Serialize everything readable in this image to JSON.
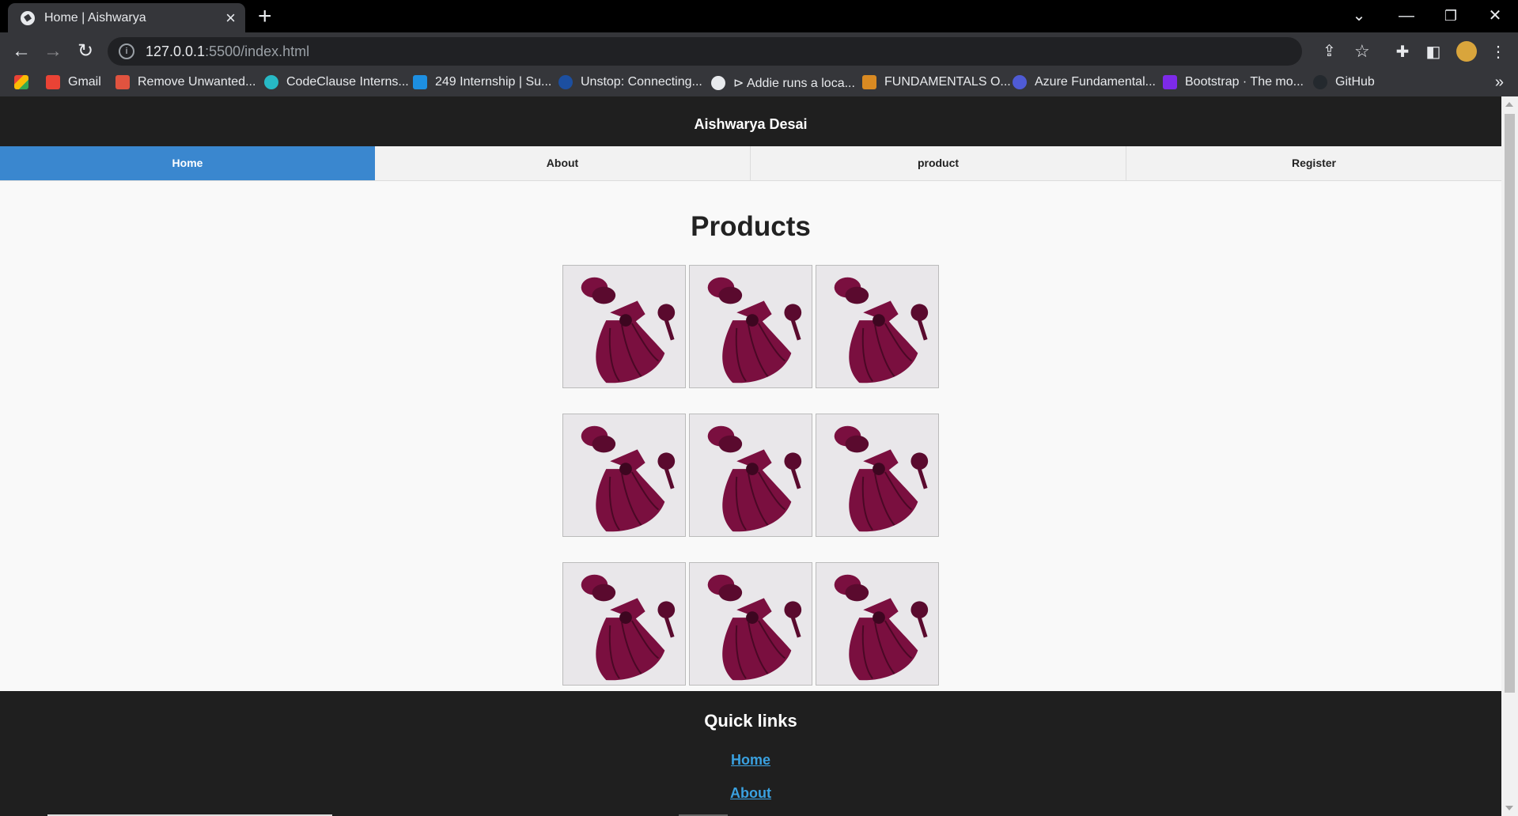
{
  "browser": {
    "tab_title": "Home | Aishwarya",
    "url_host": "127.0.0.1",
    "url_path": ":5500/index.html",
    "bookmarks": [
      {
        "label": "",
        "color": "#e8c33a"
      },
      {
        "label": "Gmail",
        "color": "#ea4335"
      },
      {
        "label": "Remove Unwanted...",
        "color": "#e0533f"
      },
      {
        "label": "CodeClause Interns...",
        "color": "#27b9c5"
      },
      {
        "label": "249 Internship | Su...",
        "color": "#1d8fe1"
      },
      {
        "label": "Unstop: Connecting...",
        "color": "#1c4fa0"
      },
      {
        "label": "⊳ Addie runs a loca...",
        "color": "#e8eaed"
      },
      {
        "label": "FUNDAMENTALS O...",
        "color": "#d98a22"
      },
      {
        "label": "Azure Fundamental...",
        "color": "#4f5bd5"
      },
      {
        "label": "Bootstrap · The mo...",
        "color": "#7d2ae8"
      },
      {
        "label": "GitHub",
        "color": "#24292e"
      }
    ]
  },
  "site": {
    "brand": "Aishwarya Desai",
    "nav": [
      {
        "label": "Home",
        "active": true
      },
      {
        "label": "About",
        "active": false
      },
      {
        "label": "product",
        "active": false
      },
      {
        "label": "Register",
        "active": false
      }
    ],
    "products_title": "Products",
    "product_count": 9,
    "footer": {
      "heading": "Quick links",
      "links": [
        "Home",
        "About"
      ]
    }
  },
  "colors": {
    "accent": "#3a87cf",
    "header_bg": "#1f1f1f",
    "link": "#3aa1e0",
    "dress": "#7a0f3f"
  }
}
